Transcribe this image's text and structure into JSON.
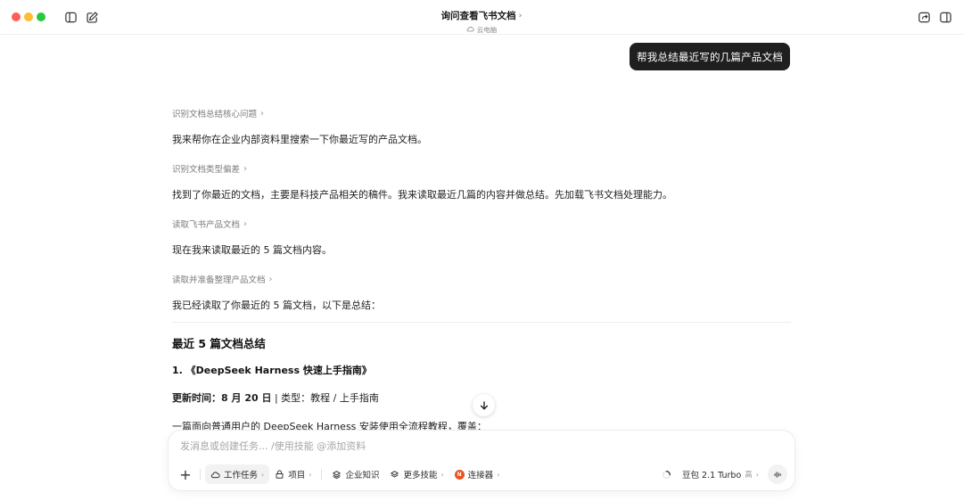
{
  "window": {
    "title": "询问查看飞书文档",
    "subtitle": "云电脑"
  },
  "user_message": "帮我总结最近写的几篇产品文档",
  "steps": [
    {
      "label": "识别文档总结核心问题",
      "text": "我来帮你在企业内部资料里搜索一下你最近写的产品文档。"
    },
    {
      "label": "识别文档类型偏差",
      "text": "找到了你最近的文档，主要是科技产品相关的稿件。我来读取最近几篇的内容并做总结。先加载飞书文档处理能力。"
    },
    {
      "label": "读取飞书产品文档",
      "text": "现在我来读取最近的 5 篇文档内容。"
    },
    {
      "label": "读取并准备整理产品文档",
      "text": "我已经读取了你最近的 5 篇文档，以下是总结："
    }
  ],
  "summary": {
    "heading": "最近 5 篇文档总结",
    "doc_title": "1. 《DeepSeek Harness 快速上手指南》",
    "meta_label": "更新时间：8 月 20 日",
    "meta_rest": " | 类型：教程 / 上手指南",
    "intro": "一篇面向普通用户的 DeepSeek Harness 安装使用全流程教程，覆盖："
  },
  "composer": {
    "placeholder": "发消息或创建任务... /使用技能 @添加资料",
    "buttons": {
      "task": "工作任务",
      "project": "项目",
      "knowledge": "企业知识",
      "skills": "更多技能",
      "connector": "连接器"
    },
    "model_name": "豆包 2.1 Turbo",
    "model_tag": "高"
  },
  "colors": {
    "bubble_bg": "#1f1f1f",
    "connector_accent": "#f0521d"
  }
}
